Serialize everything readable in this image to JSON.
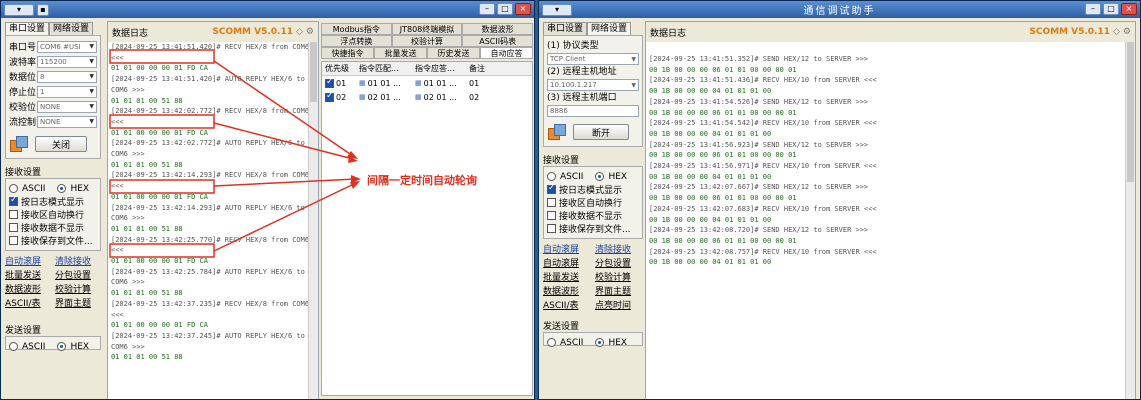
{
  "left": {
    "title": "",
    "tabs": [
      "串口设置",
      "网络设置"
    ],
    "fields": [
      {
        "label": "串口号",
        "value": "COM6 #USI"
      },
      {
        "label": "波特率",
        "value": "115200"
      },
      {
        "label": "数据位",
        "value": "8"
      },
      {
        "label": "停止位",
        "value": "1"
      },
      {
        "label": "校验位",
        "value": "NONE"
      },
      {
        "label": "流控制",
        "value": "NONE"
      }
    ],
    "close_button": "关闭",
    "recv_title": "接收设置",
    "recv_ascii": "ASCII",
    "recv_hex": "HEX",
    "recv_options": [
      {
        "label": "按日志模式显示",
        "checked": true
      },
      {
        "label": "接收区自动换行",
        "checked": false
      },
      {
        "label": "接收数据不显示",
        "checked": false
      },
      {
        "label": "接收保存到文件...",
        "checked": false
      }
    ],
    "links": [
      "自动滚屏",
      "清除接收",
      "批量发送",
      "分包设置",
      "数据波形",
      "校验计算",
      "ASCII/表",
      "界面主题"
    ],
    "send_title": "发送设置",
    "send_ascii": "ASCII",
    "send_hex": "HEX",
    "log_header": "数据日志",
    "brand": "SCOMM V5.0.11",
    "log_lines": [
      {
        "t": "recv",
        "text": "[2024-09-25 13:41:51.420]# RECV HEX/8 from COM6"
      },
      {
        "t": "recv",
        "text": "<<<"
      },
      {
        "t": "hex",
        "text": "01 01 00 00 00 01 FD CA"
      },
      {
        "t": "recv",
        "text": "[2024-09-25 13:41:51.420]# AUTO REPLY HEX/6 to"
      },
      {
        "t": "recv",
        "text": "COM6 >>>"
      },
      {
        "t": "hex",
        "text": "01 01 01 00 51 88"
      },
      {
        "t": "recv",
        "text": "[2024-09-25 13:42:02.772]# RECV HEX/8 from COM6"
      },
      {
        "t": "recv",
        "text": "<<<"
      },
      {
        "t": "hex",
        "text": "01 01 00 00 00 01 FD CA"
      },
      {
        "t": "recv",
        "text": "[2024-09-25 13:42:02.772]# AUTO REPLY HEX/6 to"
      },
      {
        "t": "recv",
        "text": "COM6 >>>"
      },
      {
        "t": "hex",
        "text": "01 01 01 00 51 88"
      },
      {
        "t": "recv",
        "text": "[2024-09-25 13:42:14.293]# RECV HEX/8 from COM6"
      },
      {
        "t": "recv",
        "text": "<<<"
      },
      {
        "t": "hex",
        "text": "01 01 00 00 00 01 FD CA"
      },
      {
        "t": "recv",
        "text": "[2024-09-25 13:42:14.293]# AUTO REPLY HEX/6 to"
      },
      {
        "t": "recv",
        "text": "COM6 >>>"
      },
      {
        "t": "hex",
        "text": "01 01 01 00 51 88"
      },
      {
        "t": "recv",
        "text": "[2024-09-25 13:42:25.770]# RECV HEX/8 from COM6"
      },
      {
        "t": "recv",
        "text": "<<<"
      },
      {
        "t": "hex",
        "text": "01 01 00 00 00 01 FD CA"
      },
      {
        "t": "recv",
        "text": "[2024-09-25 13:42:25.784]# AUTO REPLY HEX/6 to"
      },
      {
        "t": "recv",
        "text": "COM6 >>>"
      },
      {
        "t": "hex",
        "text": "01 01 01 00 51 88"
      },
      {
        "t": "recv",
        "text": "[2024-09-25 13:42:37.235]# RECV HEX/8 from COM6"
      },
      {
        "t": "recv",
        "text": "<<<"
      },
      {
        "t": "hex",
        "text": "01 01 00 00 00 01 FD CA"
      },
      {
        "t": "recv",
        "text": "[2024-09-25 13:42:37.245]# AUTO REPLY HEX/6 to"
      },
      {
        "t": "recv",
        "text": "COM6 >>>"
      },
      {
        "t": "hex",
        "text": "01 01 01 00 51 88"
      }
    ],
    "right_tabs": [
      "Modbus指令",
      "JT808终端模拟",
      "数据波形",
      "浮点转换",
      "校验计算",
      "ASCII码表",
      "快捷指令",
      "批量发送",
      "历史发送",
      "自动应答"
    ],
    "cmd_headers": [
      "优先级",
      "指令匹配...",
      "指令应答...",
      "备注"
    ],
    "cmd_rows": [
      {
        "p": "01",
        "match": "01 01 ...",
        "reply": "01 01 ...",
        "note": "01"
      },
      {
        "p": "02",
        "match": "02 01 ...",
        "reply": "02 01 ...",
        "note": "02"
      }
    ],
    "annotation": "间隔一定时间自动轮询"
  },
  "right": {
    "title": "通信调试助手",
    "tabs": [
      "串口设置",
      "网络设置"
    ],
    "proto_label": "(1) 协议类型",
    "proto_value": "TCP Client",
    "host_label": "(2) 远程主机地址",
    "host_value": "10.100.1.217",
    "port_label": "(3) 远程主机端口",
    "port_value": "8886",
    "disconnect": "断开",
    "recv_title": "接收设置",
    "recv_ascii": "ASCII",
    "recv_hex": "HEX",
    "recv_options": [
      {
        "label": "按日志模式显示",
        "checked": true
      },
      {
        "label": "接收区自动换行",
        "checked": false
      },
      {
        "label": "接收数据不显示",
        "checked": false
      },
      {
        "label": "接收保存到文件...",
        "checked": false
      }
    ],
    "links": [
      "自动滚屏",
      "清除接收",
      "自动滚屏",
      "分包设置",
      "批量发送",
      "校验计算",
      "数据波形",
      "界面主题",
      "ASCII/表",
      "点亮时间"
    ],
    "send_title": "发送设置",
    "send_ascii": "ASCII",
    "send_hex": "HEX",
    "log_header": "数据日志",
    "brand": "SCOMM V5.0.11",
    "log_lines": [
      {
        "t": "recv",
        "text": "[2024-09-25 13:41:51.352]# SEND HEX/12 to SERVER >>>"
      },
      {
        "t": "hex",
        "text": "00 1B 00 00 00 06 01 01 00 00 00 01"
      },
      {
        "t": "recv",
        "text": "[2024-09-25 13:41:51.436]# RECV HEX/10 from SERVER <<<"
      },
      {
        "t": "hex",
        "text": "00 1B 00 00 00 04 01 01 01 00"
      },
      {
        "t": "recv",
        "text": "[2024-09-25 13:41:54.526]# SEND HEX/12 to SERVER >>>"
      },
      {
        "t": "hex",
        "text": "00 1B 00 00 00 06 01 01 00 00 00 01"
      },
      {
        "t": "recv",
        "text": "[2024-09-25 13:41:54.542]# RECV HEX/10 from SERVER <<<"
      },
      {
        "t": "hex",
        "text": "00 1B 00 00 00 04 01 01 01 00"
      },
      {
        "t": "recv",
        "text": "[2024-09-25 13:41:56.923]# SEND HEX/12 to SERVER >>>"
      },
      {
        "t": "hex",
        "text": "00 1B 00 00 00 06 01 01 00 00 00 01"
      },
      {
        "t": "recv",
        "text": "[2024-09-25 13:41:56.971]# RECV HEX/10 from SERVER <<<"
      },
      {
        "t": "hex",
        "text": "00 1B 00 00 00 04 01 01 01 00"
      },
      {
        "t": "recv",
        "text": "[2024-09-25 13:42:07.667]# SEND HEX/12 to SERVER >>>"
      },
      {
        "t": "hex",
        "text": "00 1B 00 00 00 06 01 01 00 00 00 01"
      },
      {
        "t": "recv",
        "text": "[2024-09-25 13:42:07.683]# RECV HEX/10 from SERVER <<<"
      },
      {
        "t": "hex",
        "text": "00 1B 00 00 00 04 01 01 01 00"
      },
      {
        "t": "recv",
        "text": "[2024-09-25 13:42:08.720]# SEND HEX/12 to SERVER >>>"
      },
      {
        "t": "hex",
        "text": "00 1B 00 00 00 06 01 01 00 00 00 01"
      },
      {
        "t": "recv",
        "text": "[2024-09-25 13:42:08.757]# RECV HEX/10 from SERVER <<<"
      },
      {
        "t": "hex",
        "text": "00 1B 00 00 00 04 01 01 01 00"
      }
    ]
  },
  "colors": {
    "accent": "#e07a10",
    "title_bar": "#2c5fa8",
    "hex_text": "#1e6e1e",
    "annotation": "#e03020"
  }
}
